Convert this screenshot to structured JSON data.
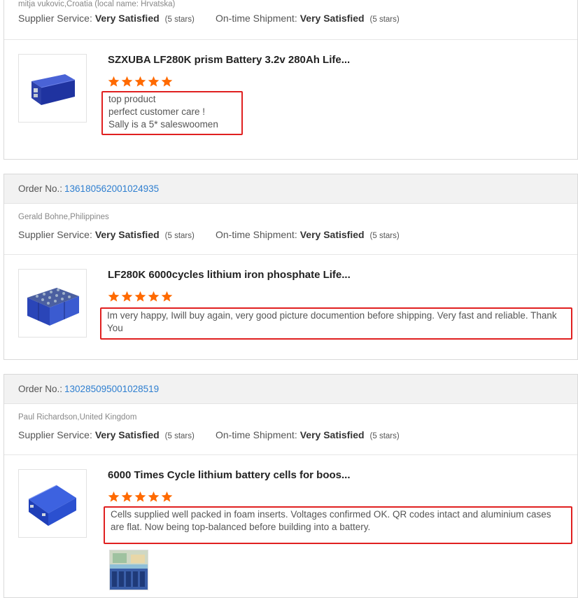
{
  "colors": {
    "accent_link": "#2f7fd0",
    "star": "#ff6a00",
    "highlight_border": "#e02020"
  },
  "labels": {
    "order_no": "Order No.:",
    "supplier_service": "Supplier Service:",
    "ontime_shipment": "On-time Shipment:"
  },
  "reviews": [
    {
      "buyer": "mitja vukovic,Croatia (local name: Hrvatska)",
      "supplier_service": {
        "value": "Very Satisfied",
        "stars_text": "(5 stars)"
      },
      "ontime_shipment": {
        "value": "Very Satisfied",
        "stars_text": "(5 stars)"
      },
      "product_title": "SZXUBA LF280K prism Battery 3.2v 280Ah Life...",
      "rating": 5,
      "review_lines": [
        "top product",
        "perfect customer care !",
        "Sally is a 5* saleswoomen"
      ]
    },
    {
      "order_no": "136180562001024935",
      "buyer": "Gerald Bohne,Philippines",
      "supplier_service": {
        "value": "Very Satisfied",
        "stars_text": "(5 stars)"
      },
      "ontime_shipment": {
        "value": "Very Satisfied",
        "stars_text": "(5 stars)"
      },
      "product_title": "LF280K 6000cycles lithium iron phosphate Life...",
      "rating": 5,
      "review_lines": [
        "Im very happy, Iwill buy again, very good picture documention before shipping. Very fast and reliable. Thank You"
      ]
    },
    {
      "order_no": "130285095001028519",
      "buyer": "Paul Richardson,United Kingdom",
      "supplier_service": {
        "value": "Very Satisfied",
        "stars_text": "(5 stars)"
      },
      "ontime_shipment": {
        "value": "Very Satisfied",
        "stars_text": "(5 stars)"
      },
      "product_title": "6000 Times Cycle lithium battery cells for boos...",
      "rating": 5,
      "review_lines": [
        "Cells supplied well packed in foam inserts. Voltages confirmed OK. QR codes intact and aluminium cases are flat. Now being top-balanced before building into a battery."
      ]
    }
  ]
}
